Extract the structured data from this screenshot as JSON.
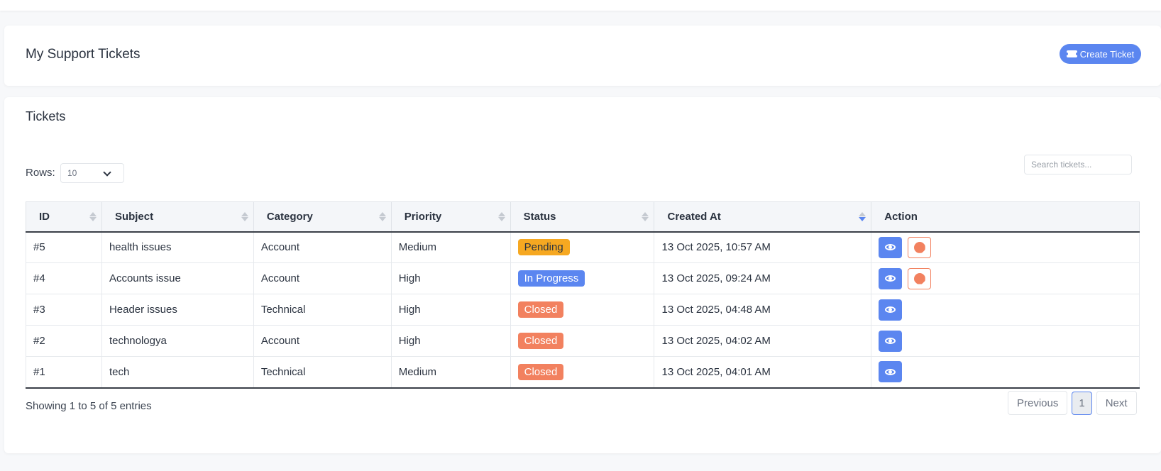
{
  "header": {
    "title": "My Support Tickets",
    "create_button": "Create Ticket"
  },
  "tickets_section": {
    "title": "Tickets",
    "rows_label": "Rows:",
    "rows_value": "10",
    "search_placeholder": "Search tickets..."
  },
  "table": {
    "columns": [
      "ID",
      "Subject",
      "Category",
      "Priority",
      "Status",
      "Created At",
      "Action"
    ],
    "sorted_column": "Created At",
    "rows": [
      {
        "id": "#5",
        "subject": "health issues",
        "category": "Account",
        "priority": "Medium",
        "status": "Pending",
        "created": "13 Oct 2025, 10:57 AM",
        "can_close": true
      },
      {
        "id": "#4",
        "subject": "Accounts issue",
        "category": "Account",
        "priority": "High",
        "status": "In Progress",
        "created": "13 Oct 2025, 09:24 AM",
        "can_close": true
      },
      {
        "id": "#3",
        "subject": "Header issues",
        "category": "Technical",
        "priority": "High",
        "status": "Closed",
        "created": "13 Oct 2025, 04:48 AM",
        "can_close": false
      },
      {
        "id": "#2",
        "subject": "technologya",
        "category": "Account",
        "priority": "High",
        "status": "Closed",
        "created": "13 Oct 2025, 04:02 AM",
        "can_close": false
      },
      {
        "id": "#1",
        "subject": "tech",
        "category": "Technical",
        "priority": "Medium",
        "status": "Closed",
        "created": "13 Oct 2025, 04:01 AM",
        "can_close": false
      }
    ]
  },
  "footer": {
    "showing_text": "Showing 1 to 5 of 5 entries",
    "previous_label": "Previous",
    "current_page": "1",
    "next_label": "Next"
  },
  "colors": {
    "primary": "#5b86f0",
    "pending": "#f6a821",
    "closed": "#f2815f"
  },
  "icons": {
    "create_button": "ticket-icon",
    "view_button": "eye-icon",
    "close_button": "stop-icon",
    "rows_select": "chevron-down-icon",
    "column_sort": "sort-icon"
  }
}
